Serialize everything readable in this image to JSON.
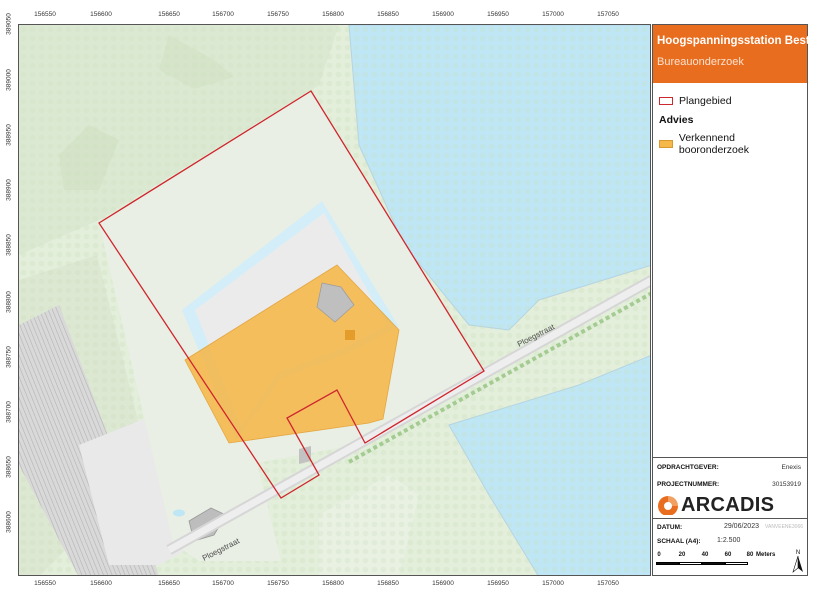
{
  "map": {
    "title": "Hoogspanningsstation Best",
    "subtitle": "Bureauonderzoek",
    "road_labels": [
      "Ploegstraat",
      "Ploegstraat"
    ],
    "easting_ticks": [
      "156550",
      "156600",
      "156650",
      "156700",
      "156750",
      "156800",
      "156850",
      "156900",
      "156950",
      "157000",
      "157050"
    ],
    "northing_ticks": [
      "389050",
      "389000",
      "388950",
      "388900",
      "388850",
      "388800",
      "388750",
      "388700",
      "388650",
      "388600"
    ]
  },
  "legend": {
    "plangebied_label": "Plangebied",
    "advies_heading": "Advies",
    "verkennend_label": "Verkennend booronderzoek"
  },
  "info": {
    "opdrachtgever_label": "OPDRACHTGEVER:",
    "opdrachtgever_value": "Enexis",
    "projectnummer_label": "PROJECTNUMMER:",
    "projectnummer_value": "30153919",
    "logo_text": "ARCADIS",
    "datum_label": "DATUM:",
    "datum_value": "29/06/2023",
    "datum_code": "VANVEENE3066",
    "schaal_label": "SCHAAL (A4):",
    "schaal_value": "1:2.500",
    "scale_ticks": [
      "0",
      "20",
      "40",
      "60",
      "80"
    ],
    "scale_unit": "Meters",
    "north_label": "N"
  },
  "colors": {
    "accent": "#e96d1f",
    "plangebied_outline": "#d0262e",
    "advies_fill": "#f6b84a",
    "water": "#bfe6f5",
    "terrain": "#e3eedb"
  }
}
